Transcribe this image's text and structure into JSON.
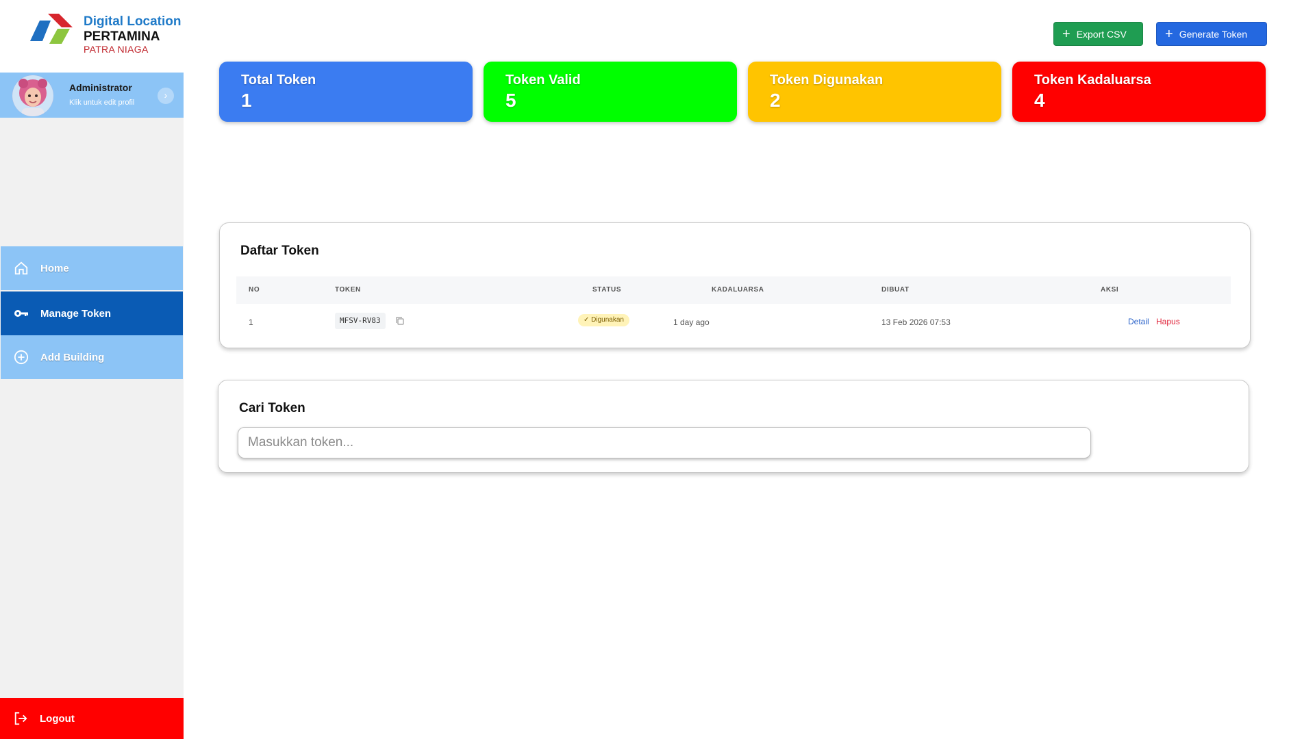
{
  "brand": {
    "line1": "Digital Location",
    "line2": "PERTAMINA",
    "line3": "PATRA NIAGA"
  },
  "profile": {
    "name": "Administrator",
    "subtitle": "Klik untuk edit profil"
  },
  "nav": {
    "items": [
      {
        "label": "Home",
        "icon": "home-icon"
      },
      {
        "label": "Manage Token",
        "icon": "key-icon",
        "active": true
      },
      {
        "label": "Add Building",
        "icon": "plus-circle-icon"
      }
    ],
    "logout": "Logout"
  },
  "toolbar": {
    "export_label": "Export CSV",
    "generate_label": "Generate Token"
  },
  "stats": [
    {
      "title": "Total Token",
      "value": "1",
      "color": "#3b7cf1"
    },
    {
      "title": "Token Valid",
      "value": "5",
      "color": "#00ff00"
    },
    {
      "title": "Token Digunakan",
      "value": "2",
      "color": "#ffc400"
    },
    {
      "title": "Token Kadaluarsa",
      "value": "4",
      "color": "#ff0000"
    }
  ],
  "token_list": {
    "title": "Daftar Token",
    "columns": [
      "NO",
      "TOKEN",
      "STATUS",
      "KADALUARSA",
      "DIBUAT",
      "AKSI"
    ],
    "rows": [
      {
        "no": "1",
        "token": "MFSV-RV83",
        "status": "Digunakan",
        "kadaluarsa": "1 day ago",
        "dibuat": "13 Feb 2026 07:53",
        "actions": {
          "detail": "Detail",
          "hapus": "Hapus"
        }
      }
    ]
  },
  "search": {
    "title": "Cari Token",
    "placeholder": "Masukkan token...",
    "value": ""
  }
}
